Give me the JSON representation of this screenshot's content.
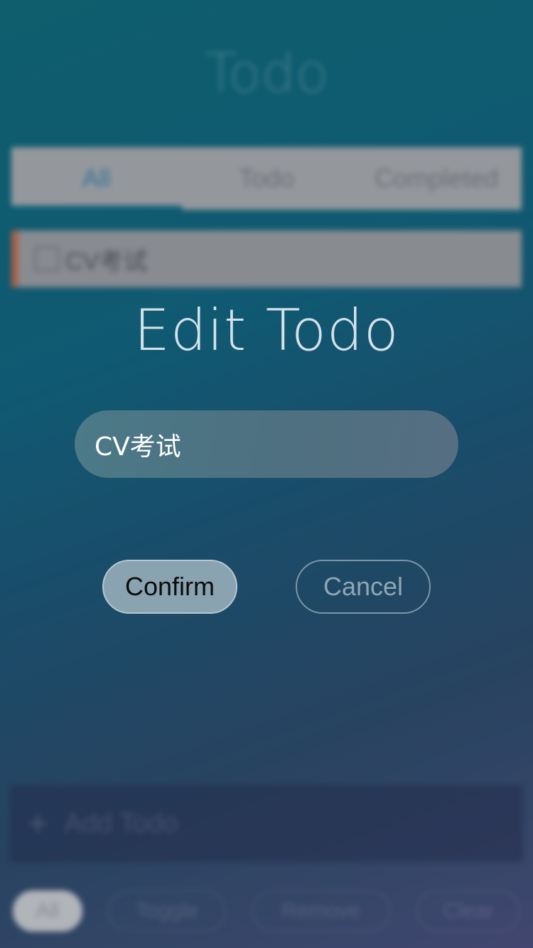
{
  "background": {
    "title": "Todo",
    "tabs": [
      "All",
      "Todo",
      "Completed"
    ],
    "todo_item": "CV考试",
    "add_placeholder": "Add Todo",
    "bottom_buttons": [
      "All",
      "Toggle",
      "Remove",
      "Clear"
    ]
  },
  "dialog": {
    "title": "Edit Todo",
    "input_value": "CV考试",
    "confirm_label": "Confirm",
    "cancel_label": "Cancel"
  },
  "colors": {
    "accent": "#106a80",
    "item_marker": "#c06a4a"
  }
}
